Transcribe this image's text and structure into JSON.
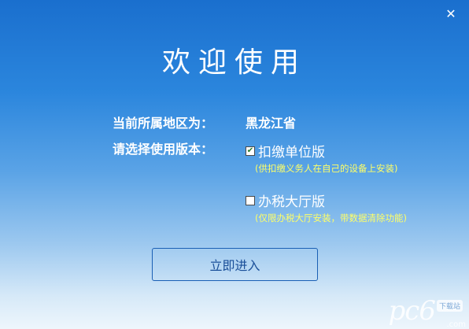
{
  "window": {
    "close_glyph": "✕"
  },
  "title": "欢迎使用",
  "region": {
    "label": "当前所属地区为：",
    "value": "黑龙江省"
  },
  "version": {
    "label": "请选择使用版本：",
    "options": [
      {
        "label": "扣缴单位版",
        "checked": true,
        "hint": "(供扣缴义务人在自己的设备上安装)"
      },
      {
        "label": "办税大厅版",
        "checked": false,
        "hint": "(仅限办税大厅安装，带数据清除功能)"
      }
    ]
  },
  "enter_button": "立即进入",
  "watermark": {
    "text": "pc6",
    "badge": "下载站",
    "sub": ".com"
  },
  "colors": {
    "background_top": "#1a6fce",
    "background_bottom": "#eef6fc",
    "hint": "#ffff66",
    "button_border": "#1a5fb4"
  }
}
